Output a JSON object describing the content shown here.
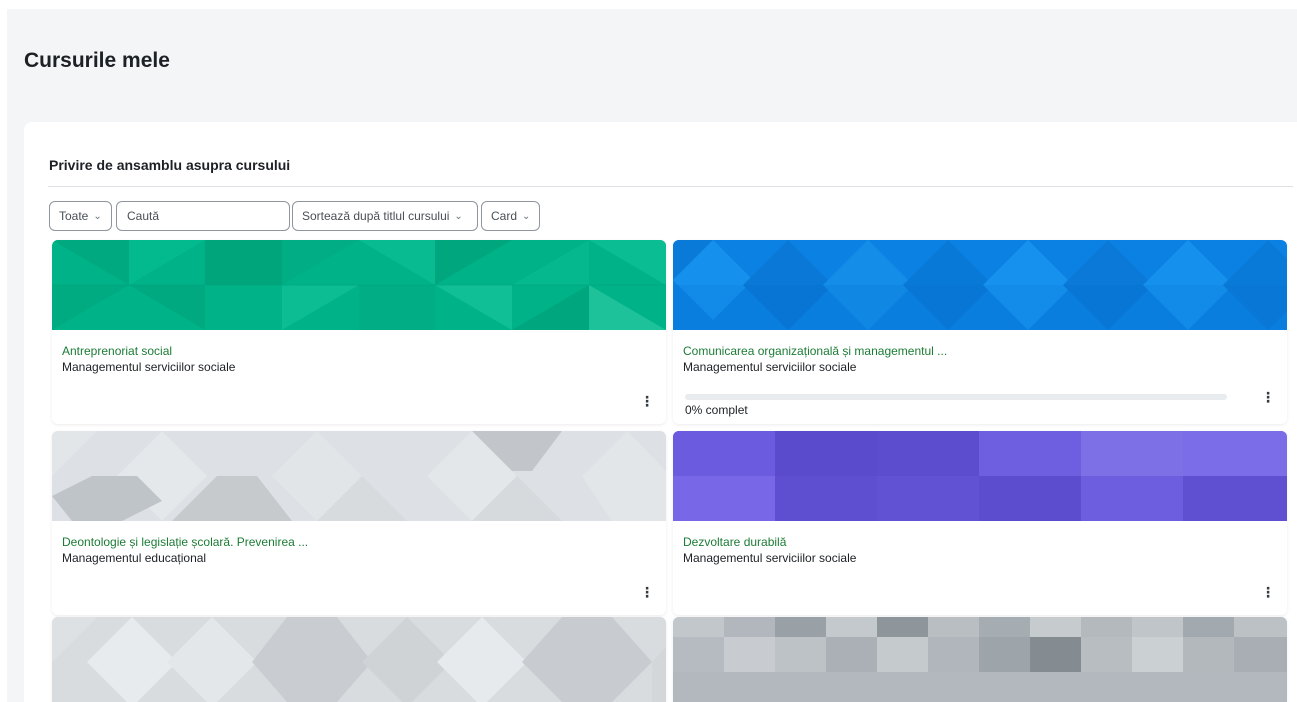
{
  "page": {
    "title": "Cursurile mele"
  },
  "block": {
    "title": "Privire de ansamblu asupra cursului"
  },
  "filters": {
    "grouping": "Toate",
    "search_placeholder": "Caută",
    "sort": "Sortează după titlul cursului",
    "view": "Card"
  },
  "colors": {
    "course_link": "#1c7c36",
    "accent": "#0f6cbf",
    "pattern_green": "#00b288",
    "pattern_blue": "#0b82e3",
    "pattern_gray": "#dde1e5",
    "pattern_purple": "#6d5fe0",
    "pattern_gray2": "#d8dcdf",
    "pattern_gray3": "#b9bfc4"
  },
  "courses": [
    {
      "name": "Antreprenoriat social",
      "category": "Managementul serviciilor sociale",
      "menu_icon": "kebab-vertical-icon"
    },
    {
      "name": "Comunicarea organizațională și managementul ...",
      "category": "Managementul serviciilor sociale",
      "progress": 0,
      "progress_label": "0% complet",
      "menu_icon": "kebab-vertical-icon"
    },
    {
      "name": "Deontologie și legislație școlară. Prevenirea ...",
      "category": "Managementul educațional",
      "menu_icon": "kebab-vertical-icon"
    },
    {
      "name": "Dezvoltare durabilă",
      "category": "Managementul serviciilor sociale",
      "menu_icon": "kebab-vertical-icon"
    },
    {
      "name": "",
      "category": ""
    },
    {
      "name": "",
      "category": ""
    }
  ]
}
